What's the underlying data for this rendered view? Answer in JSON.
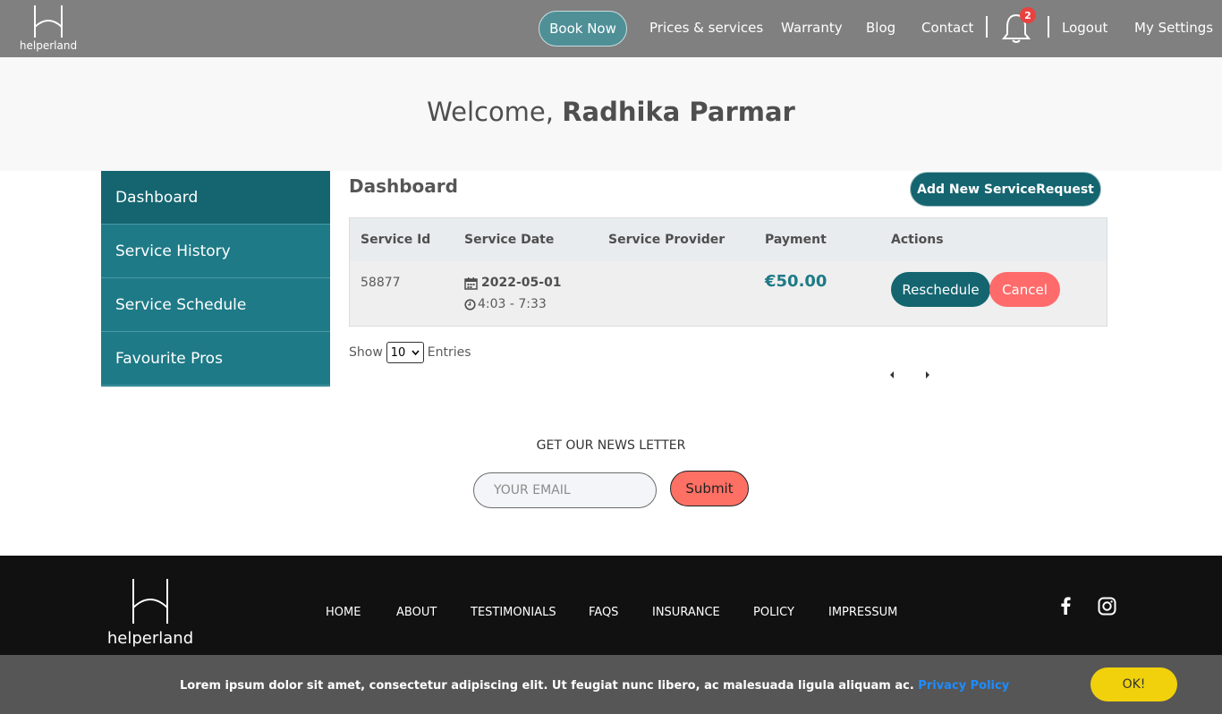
{
  "brand": {
    "name": "helperland"
  },
  "nav": {
    "book_now": "Book Now",
    "links": [
      "Prices & services",
      "Warranty",
      "Blog",
      "Contact"
    ],
    "notification_count": "2",
    "logout": "Logout",
    "settings": "My Settings"
  },
  "welcome": {
    "greeting": "Welcome,",
    "user_name": "Radhika Parmar"
  },
  "sidebar": {
    "items": [
      {
        "label": "Dashboard"
      },
      {
        "label": "Service History"
      },
      {
        "label": "Service Schedule"
      },
      {
        "label": "Favourite Pros"
      }
    ]
  },
  "main": {
    "title": "Dashboard",
    "add_button": "Add New ServiceRequest",
    "table": {
      "headers": [
        "Service Id",
        "Service Date",
        "Service Provider",
        "Payment",
        "Actions"
      ],
      "rows": [
        {
          "service_id": "58877",
          "date": "2022-05-01",
          "time": "4:03 - 7:33",
          "provider": "",
          "payment": "€50.00",
          "reschedule": "Reschedule",
          "cancel": "Cancel"
        }
      ]
    },
    "show_label": "Show",
    "entries_value": "10",
    "entries_label": "Entries"
  },
  "newsletter": {
    "title": "GET OUR NEWS LETTER",
    "placeholder": "YOUR EMAIL",
    "submit": "Submit"
  },
  "footer": {
    "links": [
      "HOME",
      "ABOUT",
      "TESTIMONIALS",
      "FAQS",
      "INSURANCE",
      "POLICY",
      "IMPRESSUM"
    ],
    "social_icons": [
      "facebook-icon",
      "instagram-icon"
    ]
  },
  "cookie": {
    "text": "Lorem ipsum dolor sit amet, consectetur adipiscing elit. Ut feugiat nunc libero, ac malesuada ligula aliquam ac.",
    "link": "Privacy Policy",
    "ok": "OK!"
  },
  "colors": {
    "nav_bg": "#808080",
    "primary_teal": "#146570",
    "sidebar_teal": "#1e7a87",
    "cancel_red": "#ff6b6b",
    "ok_yellow": "#f0d10c",
    "link_blue": "#1e8cff"
  }
}
